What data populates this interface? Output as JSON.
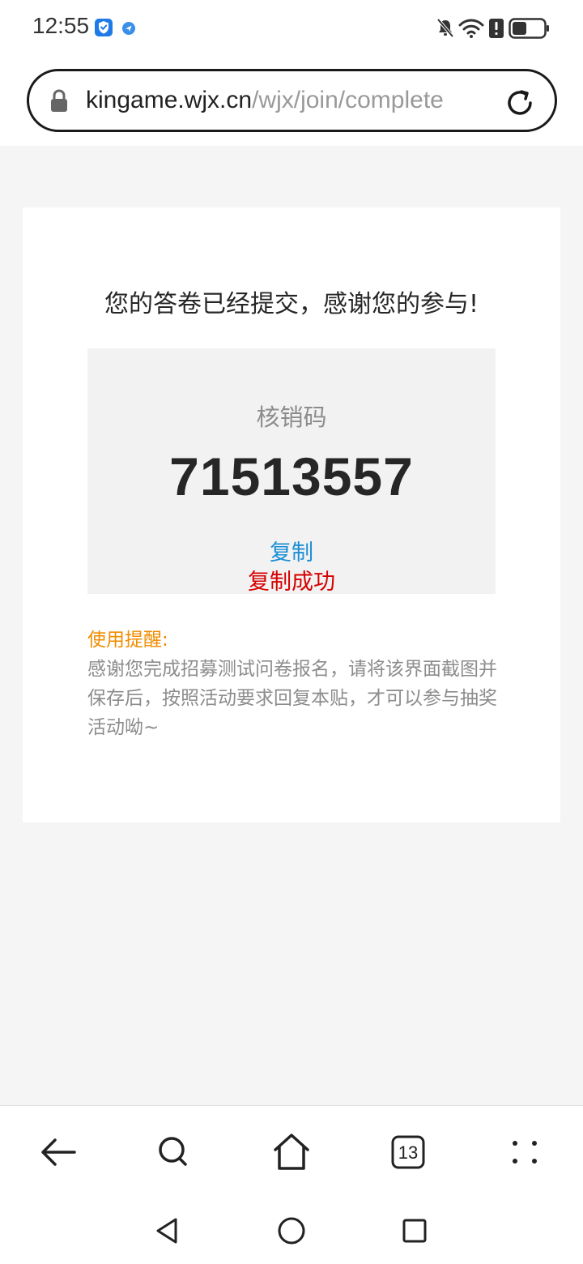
{
  "status_bar": {
    "time": "12:55",
    "icons": [
      "shield-check-icon",
      "location-dot-icon",
      "bell-off-icon",
      "wifi-icon",
      "alert-icon",
      "battery-icon"
    ]
  },
  "url_bar": {
    "host": "kingame.wjx.cn",
    "path": "/wjx/join/complete",
    "icons": [
      "lock-icon",
      "reload-icon"
    ]
  },
  "page": {
    "thanks_message": "您的答卷已经提交，感谢您的参与!",
    "code_label": "核销码",
    "code_value": "71513557",
    "copy_label": "复制",
    "copy_success": "复制成功",
    "tip_title": "使用提醒:",
    "tip_body": "感谢您完成招募测试问卷报名，请将该界面截图并保存后，按照活动要求回复本贴，才可以参与抽奖活动呦~"
  },
  "bottom_nav": {
    "tab_count": "13",
    "items": [
      "back-icon",
      "search-icon",
      "home-icon",
      "tabs-icon",
      "menu-icon"
    ]
  },
  "system_nav": {
    "items": [
      "system-back-icon",
      "system-home-icon",
      "system-recents-icon"
    ]
  },
  "colors": {
    "copy_link": "#1a8fd6",
    "copy_success": "#d60000",
    "tip_title": "#f08c00"
  }
}
